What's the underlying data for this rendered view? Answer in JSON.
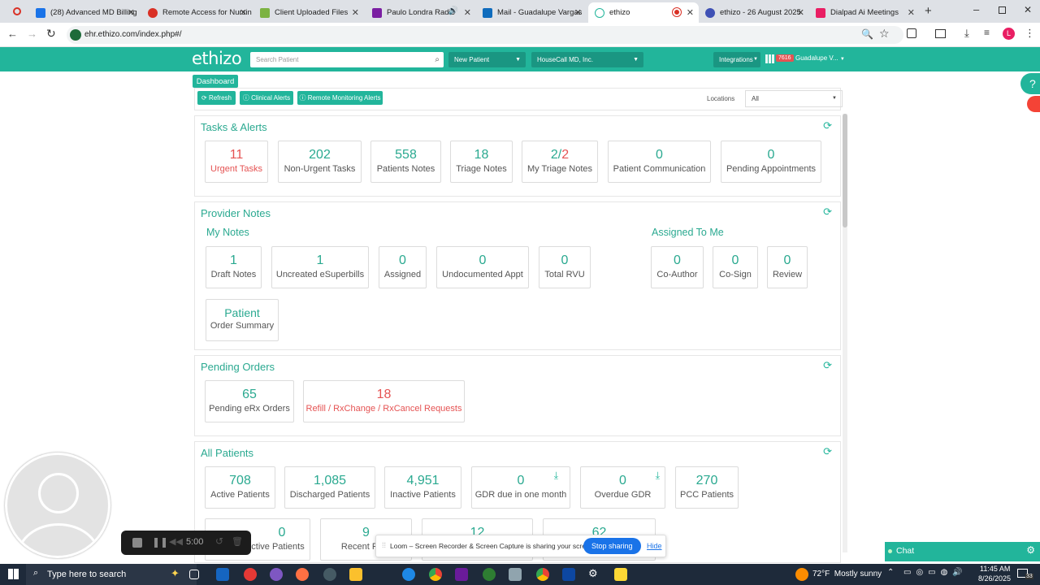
{
  "browser": {
    "tabs": [
      {
        "title": "(28) Advanced MD Billing",
        "color": "#1a73e8"
      },
      {
        "title": "Remote Access for Nursin",
        "color": "#d93025"
      },
      {
        "title": "Client Uploaded Files",
        "color": "#7cb342"
      },
      {
        "title": "Paulo Londra Radio",
        "color": "#7b1fa2"
      },
      {
        "title": "Mail - Guadalupe Vargas",
        "color": "#0f6cbd"
      },
      {
        "title": "ethizo",
        "color": "#22b59b"
      },
      {
        "title": "ethizo - 26 August 2025",
        "color": "#3f51b5"
      },
      {
        "title": "Dialpad Ai Meetings",
        "color": "#e91e63"
      }
    ],
    "url": "ehr.ethizo.com/index.php#/"
  },
  "nav": {
    "logo": "ethizo",
    "search_placeholder": "Search Patient",
    "new_patient": "New Patient",
    "practice": "HouseCall MD, Inc.",
    "integrations": "Integrations",
    "notif_count": "7616",
    "user": "Guadalupe V..."
  },
  "toolbar": {
    "dashboard": "Dashboard",
    "refresh": "⟳ Refresh",
    "clinical_alerts": "ⓘ Clinical Alerts",
    "remote_alerts": "ⓘ Remote Monitoring Alerts",
    "locations_label": "Locations",
    "locations_value": "All"
  },
  "tasks": {
    "title": "Tasks & Alerts",
    "cards": [
      {
        "n": "11",
        "l": "Urgent Tasks"
      },
      {
        "n": "202",
        "l": "Non-Urgent Tasks"
      },
      {
        "n": "558",
        "l": "Patients Notes"
      },
      {
        "n": "18",
        "l": "Triage Notes"
      },
      {
        "n_a": "2/",
        "n_b": "2",
        "l": "My Triage Notes"
      },
      {
        "n": "0",
        "l": "Patient Communication"
      },
      {
        "n": "0",
        "l": "Pending Appointments"
      }
    ]
  },
  "provider": {
    "title": "Provider Notes",
    "my_notes": "My Notes",
    "assigned_to_me": "Assigned To Me",
    "cards": [
      {
        "n": "1",
        "l": "Draft Notes"
      },
      {
        "n": "1",
        "l": "Uncreated eSuperbills"
      },
      {
        "n": "0",
        "l": "Assigned"
      },
      {
        "n": "0",
        "l": "Undocumented Appt"
      },
      {
        "n": "0",
        "l": "Total RVU"
      },
      {
        "n": "0",
        "l": "Co-Author"
      },
      {
        "n": "0",
        "l": "Co-Sign"
      },
      {
        "n": "0",
        "l": "Review"
      },
      {
        "n": "Patient",
        "l": "Order Summary"
      }
    ]
  },
  "orders": {
    "title": "Pending Orders",
    "cards": [
      {
        "n": "65",
        "l": "Pending eRx Orders"
      },
      {
        "n": "18",
        "l": "Refill / RxChange / RxCancel Requests"
      }
    ]
  },
  "patients": {
    "title": "All Patients",
    "cards": [
      {
        "n": "708",
        "l": "Active Patients"
      },
      {
        "n": "1,085",
        "l": "Discharged Patients"
      },
      {
        "n": "4,951",
        "l": "Inactive Patients"
      },
      {
        "n": "0",
        "l": "GDR due in one month"
      },
      {
        "n": "0",
        "l": "Overdue GDR"
      },
      {
        "n": "270",
        "l": "PCC Patients"
      },
      {
        "n": "0",
        "l": "ctive Patients"
      },
      {
        "n": "9",
        "l": "Recent PCC"
      },
      {
        "n": "12",
        "l": ""
      },
      {
        "n": "62",
        "l": ""
      }
    ]
  },
  "loom": {
    "timer": "5:00",
    "message": "Loom – Screen Recorder & Screen Capture is sharing your screen.",
    "stop": "Stop sharing",
    "hide": "Hide"
  },
  "chat": {
    "label": "Chat"
  },
  "taskbar": {
    "search": "Type here to search",
    "weather": "72°F  Mostly sunny",
    "time": "11:45 AM",
    "date": "8/26/2025",
    "badge": "33"
  }
}
